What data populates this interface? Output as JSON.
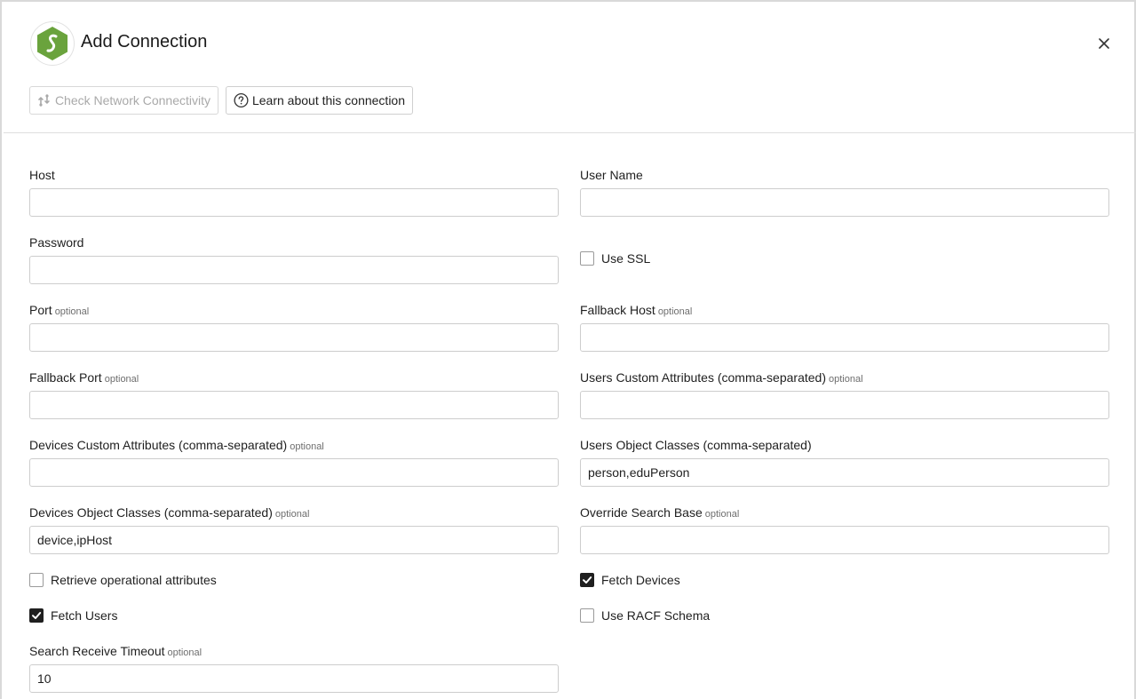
{
  "header": {
    "title": "Add Connection",
    "logo_icon": "hexagon-s-logo",
    "accent_color": "#6aa33d"
  },
  "actions": {
    "check_network_label": "Check Network Connectivity",
    "learn_label": "Learn about this connection"
  },
  "optional_tag": "optional",
  "fields": {
    "host": {
      "label": "Host",
      "value": ""
    },
    "user_name": {
      "label": "User Name",
      "value": ""
    },
    "password": {
      "label": "Password",
      "value": ""
    },
    "use_ssl": {
      "label": "Use SSL",
      "checked": false
    },
    "port": {
      "label": "Port",
      "value": ""
    },
    "fallback_host": {
      "label": "Fallback Host",
      "value": ""
    },
    "fallback_port": {
      "label": "Fallback Port",
      "value": ""
    },
    "users_custom_attributes": {
      "label": "Users Custom Attributes (comma-separated)",
      "value": ""
    },
    "devices_custom_attributes": {
      "label": "Devices Custom Attributes (comma-separated)",
      "value": ""
    },
    "users_object_classes": {
      "label": "Users Object Classes (comma-separated)",
      "value": "person,eduPerson"
    },
    "devices_object_classes": {
      "label": "Devices Object Classes (comma-separated)",
      "value": "device,ipHost"
    },
    "override_search_base": {
      "label": "Override Search Base",
      "value": ""
    },
    "retrieve_operational_attributes": {
      "label": "Retrieve operational attributes",
      "checked": false
    },
    "fetch_devices": {
      "label": "Fetch Devices",
      "checked": true
    },
    "fetch_users": {
      "label": "Fetch Users",
      "checked": true
    },
    "use_racf_schema": {
      "label": "Use RACF Schema",
      "checked": false
    },
    "search_receive_timeout": {
      "label": "Search Receive Timeout",
      "value": "10"
    }
  }
}
